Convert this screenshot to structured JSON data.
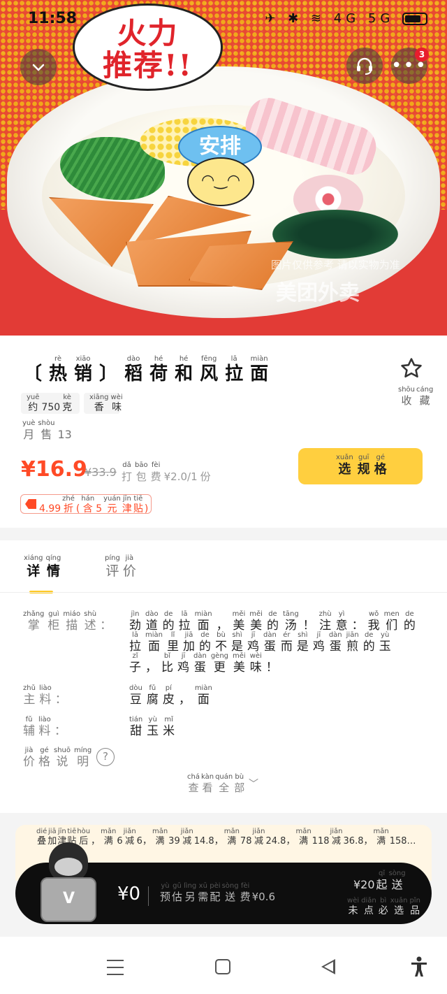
{
  "status_bar": {
    "time": "11:58",
    "icons": "✈ ✱ ≋ 4G 5G"
  },
  "hero": {
    "bubble_text_line1": "火力",
    "bubble_text_line2": "推荐!!",
    "sticker_text": "安排",
    "watermark_line1": "图片仅供参考 请以实物为准",
    "watermark_line2": "美团外卖",
    "more_badge": "3"
  },
  "product": {
    "title": [
      {
        "py": "",
        "hz": "〔"
      },
      {
        "py": "rè",
        "hz": "热"
      },
      {
        "py": "xiāo",
        "hz": "销"
      },
      {
        "py": "",
        "hz": "〕"
      },
      {
        "py": "dào",
        "hz": "稻"
      },
      {
        "py": "hé",
        "hz": "荷"
      },
      {
        "py": "hé",
        "hz": "和"
      },
      {
        "py": "fēng",
        "hz": "风"
      },
      {
        "py": "lā",
        "hz": "拉"
      },
      {
        "py": "miàn",
        "hz": "面"
      }
    ],
    "favorite": [
      {
        "py": "shōu",
        "hz": "收"
      },
      {
        "py": "cáng",
        "hz": "藏"
      }
    ],
    "tag_weight": [
      {
        "py": "yuē",
        "hz": "约"
      },
      {
        "py": "",
        "hz": "750"
      },
      {
        "py": "kè",
        "hz": "克"
      }
    ],
    "tag_flavor": [
      {
        "py": "xiāng",
        "hz": "香"
      },
      {
        "py": "wèi",
        "hz": "味"
      }
    ],
    "sales": [
      {
        "py": "yuè",
        "hz": "月"
      },
      {
        "py": "shòu",
        "hz": "售"
      },
      {
        "py": "",
        "hz": "13"
      }
    ],
    "price": "¥16.9",
    "original_price": "¥33.9",
    "packing_fee": [
      {
        "py": "dǎ",
        "hz": "打"
      },
      {
        "py": "bāo",
        "hz": "包"
      },
      {
        "py": "fèi",
        "hz": "费"
      },
      {
        "py": "",
        "hz": "¥2.0/1"
      },
      {
        "py": "",
        "hz": "份"
      }
    ],
    "spec_button": [
      {
        "py": "xuǎn",
        "hz": "选"
      },
      {
        "py": "guī",
        "hz": "规"
      },
      {
        "py": "gé",
        "hz": "格"
      }
    ],
    "discount": [
      {
        "py": "",
        "hz": "4.99"
      },
      {
        "py": "zhé",
        "hz": "折"
      },
      {
        "py": "",
        "hz": "("
      },
      {
        "py": "hán",
        "hz": "含"
      },
      {
        "py": "",
        "hz": "5"
      },
      {
        "py": "yuán",
        "hz": "元"
      },
      {
        "py": "jīn",
        "hz": "津"
      },
      {
        "py": "tiē",
        "hz": "贴"
      },
      {
        "py": "",
        "hz": ")"
      }
    ]
  },
  "tabs": {
    "detail": [
      {
        "py": "xiáng",
        "hz": "详"
      },
      {
        "py": "qíng",
        "hz": "情"
      }
    ],
    "review": [
      {
        "py": "píng",
        "hz": "评"
      },
      {
        "py": "jià",
        "hz": "价"
      }
    ]
  },
  "details": {
    "desc_label": [
      {
        "py": "zhǎng",
        "hz": "掌"
      },
      {
        "py": "guì",
        "hz": "柜"
      },
      {
        "py": "miáo",
        "hz": "描"
      },
      {
        "py": "shù",
        "hz": "述"
      },
      {
        "py": "",
        "hz": "："
      }
    ],
    "desc_line1": [
      {
        "py": "jìn",
        "hz": "劲"
      },
      {
        "py": "dào",
        "hz": "道"
      },
      {
        "py": "de",
        "hz": "的"
      },
      {
        "py": "lā",
        "hz": "拉"
      },
      {
        "py": "miàn",
        "hz": "面"
      },
      {
        "py": "",
        "hz": "，"
      },
      {
        "py": "měi",
        "hz": "美"
      },
      {
        "py": "měi",
        "hz": "美"
      },
      {
        "py": "de",
        "hz": "的"
      },
      {
        "py": "tāng",
        "hz": "汤"
      },
      {
        "py": "",
        "hz": "！"
      },
      {
        "py": "zhù",
        "hz": "注"
      },
      {
        "py": "yì",
        "hz": "意"
      },
      {
        "py": "",
        "hz": "："
      },
      {
        "py": "wǒ",
        "hz": "我"
      },
      {
        "py": "men",
        "hz": "们"
      },
      {
        "py": "de",
        "hz": "的"
      }
    ],
    "desc_line2": [
      {
        "py": "lā",
        "hz": "拉"
      },
      {
        "py": "miàn",
        "hz": "面"
      },
      {
        "py": "lǐ",
        "hz": "里"
      },
      {
        "py": "jiā",
        "hz": "加"
      },
      {
        "py": "de",
        "hz": "的"
      },
      {
        "py": "bù",
        "hz": "不"
      },
      {
        "py": "shì",
        "hz": "是"
      },
      {
        "py": "jī",
        "hz": "鸡"
      },
      {
        "py": "dàn",
        "hz": "蛋"
      },
      {
        "py": "ér",
        "hz": "而"
      },
      {
        "py": "shì",
        "hz": "是"
      },
      {
        "py": "jī",
        "hz": "鸡"
      },
      {
        "py": "dàn",
        "hz": "蛋"
      },
      {
        "py": "jiān",
        "hz": "煎"
      },
      {
        "py": "de",
        "hz": "的"
      },
      {
        "py": "yù",
        "hz": "玉"
      }
    ],
    "desc_line3": [
      {
        "py": "zǐ",
        "hz": "子"
      },
      {
        "py": "",
        "hz": "，"
      },
      {
        "py": "bǐ",
        "hz": "比"
      },
      {
        "py": "jī",
        "hz": "鸡"
      },
      {
        "py": "dàn",
        "hz": "蛋"
      },
      {
        "py": "gèng",
        "hz": "更"
      },
      {
        "py": "měi",
        "hz": "美"
      },
      {
        "py": "wèi",
        "hz": "味"
      },
      {
        "py": "",
        "hz": "！"
      }
    ],
    "main_label": [
      {
        "py": "zhǔ",
        "hz": "主"
      },
      {
        "py": "liào",
        "hz": "料"
      },
      {
        "py": "",
        "hz": "："
      }
    ],
    "main_value": [
      {
        "py": "dòu",
        "hz": "豆"
      },
      {
        "py": "fǔ",
        "hz": "腐"
      },
      {
        "py": "pí",
        "hz": "皮"
      },
      {
        "py": "",
        "hz": "，"
      },
      {
        "py": "miàn",
        "hz": "面"
      }
    ],
    "aux_label": [
      {
        "py": "fǔ",
        "hz": "辅"
      },
      {
        "py": "liào",
        "hz": "料"
      },
      {
        "py": "",
        "hz": "："
      }
    ],
    "aux_value": [
      {
        "py": "tián",
        "hz": "甜"
      },
      {
        "py": "yù",
        "hz": "玉"
      },
      {
        "py": "mǐ",
        "hz": "米"
      }
    ],
    "price_label": [
      {
        "py": "jià",
        "hz": "价"
      },
      {
        "py": "gé",
        "hz": "格"
      },
      {
        "py": "shuō",
        "hz": "说"
      },
      {
        "py": "míng",
        "hz": "明"
      }
    ],
    "help_icon": "?",
    "view_all": [
      {
        "py": "chá",
        "hz": "查"
      },
      {
        "py": "kàn",
        "hz": "看"
      },
      {
        "py": "quán",
        "hz": "全"
      },
      {
        "py": "bù",
        "hz": "部"
      }
    ],
    "chevron": "﹀"
  },
  "promo": [
    {
      "py": "dié",
      "hz": "叠"
    },
    {
      "py": "jiā",
      "hz": "加"
    },
    {
      "py": "jīn",
      "hz": "津"
    },
    {
      "py": "tiē",
      "hz": "贴"
    },
    {
      "py": "hòu",
      "hz": "后"
    },
    {
      "py": "",
      "hz": "，"
    },
    {
      "py": "mǎn",
      "hz": "满"
    },
    {
      "py": "",
      "hz": "6"
    },
    {
      "py": "jiǎn",
      "hz": "减"
    },
    {
      "py": "",
      "hz": "6，"
    },
    {
      "py": "mǎn",
      "hz": "满"
    },
    {
      "py": "",
      "hz": "39"
    },
    {
      "py": "jiǎn",
      "hz": "减"
    },
    {
      "py": "",
      "hz": "14.8，"
    },
    {
      "py": "mǎn",
      "hz": "满"
    },
    {
      "py": "",
      "hz": "78"
    },
    {
      "py": "jiǎn",
      "hz": "减"
    },
    {
      "py": "",
      "hz": "24.8，"
    },
    {
      "py": "mǎn",
      "hz": "满"
    },
    {
      "py": "",
      "hz": "118"
    },
    {
      "py": "jiǎn",
      "hz": "减"
    },
    {
      "py": "",
      "hz": "36.8，"
    },
    {
      "py": "mǎn",
      "hz": "满"
    },
    {
      "py": "",
      "hz": "158…"
    }
  ],
  "cart": {
    "amount": "¥0",
    "hint": [
      {
        "py": "yù",
        "hz": "预"
      },
      {
        "py": "gū",
        "hz": "估"
      },
      {
        "py": "lìng",
        "hz": "另"
      },
      {
        "py": "xū",
        "hz": "需"
      },
      {
        "py": "pèi",
        "hz": "配"
      },
      {
        "py": "sòng",
        "hz": "送"
      },
      {
        "py": "fèi",
        "hz": "费"
      },
      {
        "py": "",
        "hz": "¥0.6"
      }
    ],
    "min_order": [
      {
        "py": "",
        "hz": "¥20"
      },
      {
        "py": "qǐ",
        "hz": "起"
      },
      {
        "py": "sòng",
        "hz": "送"
      }
    ],
    "must_select": [
      {
        "py": "wèi",
        "hz": "未"
      },
      {
        "py": "diǎn",
        "hz": "点"
      },
      {
        "py": "bì",
        "hz": "必"
      },
      {
        "py": "xuǎn",
        "hz": "选"
      },
      {
        "py": "pǐn",
        "hz": "品"
      }
    ],
    "rider_glyph": "V"
  },
  "colors": {
    "accent_yellow": "#ffcf3f",
    "price_red": "#ff4a26",
    "badge_red": "#e81d2d"
  }
}
